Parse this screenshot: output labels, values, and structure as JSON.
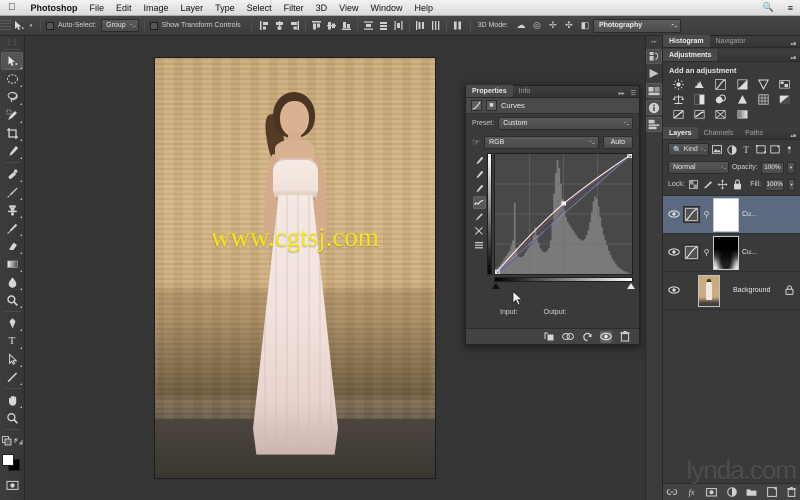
{
  "os_menu": {
    "apple_icon": "apple-icon",
    "items": [
      {
        "label": "Photoshop",
        "bold": true
      },
      {
        "label": "File",
        "bold": false
      },
      {
        "label": "Edit",
        "bold": false
      },
      {
        "label": "Image",
        "bold": false
      },
      {
        "label": "Layer",
        "bold": false
      },
      {
        "label": "Type",
        "bold": false
      },
      {
        "label": "Select",
        "bold": false
      },
      {
        "label": "Filter",
        "bold": false
      },
      {
        "label": "3D",
        "bold": false
      },
      {
        "label": "View",
        "bold": false
      },
      {
        "label": "Window",
        "bold": false
      },
      {
        "label": "Help",
        "bold": false
      }
    ],
    "right_icons": [
      "search-icon",
      "list-icon"
    ]
  },
  "options_bar": {
    "tool_icon": "move-tool-icon",
    "auto_select_label": "Auto-Select:",
    "auto_select_value": "Group",
    "show_transform_label": "Show Transform Controls",
    "threed_mode_label": "3D Mode:",
    "workspace": "Photography",
    "align_icons": [
      "align-left-edges-icon",
      "align-horizontal-centers-icon",
      "align-right-edges-icon",
      "align-top-edges-icon",
      "align-vertical-centers-icon",
      "align-bottom-edges-icon"
    ],
    "distribute_icons": [
      "distribute-top-icon",
      "distribute-vertical-center-icon",
      "distribute-bottom-icon",
      "distribute-left-icon",
      "distribute-horizontal-center-icon",
      "distribute-right-icon"
    ],
    "threed_icons": [
      "orbit-3d-icon",
      "roll-3d-icon",
      "pan-3d-icon",
      "slide-3d-icon",
      "camera-3d-icon"
    ]
  },
  "toolbar": {
    "tools": [
      {
        "name": "move-tool",
        "glyph": "↖",
        "selected": true,
        "has_submenu": true
      },
      {
        "name": "marquee-tool",
        "glyph": "◯",
        "selected": false,
        "has_submenu": true
      },
      {
        "name": "lasso-tool",
        "glyph": "⌀",
        "selected": false,
        "has_submenu": true
      },
      {
        "name": "quick-selection-tool",
        "glyph": "✎",
        "selected": false,
        "has_submenu": true
      },
      {
        "name": "crop-tool",
        "glyph": "⌗",
        "selected": false,
        "has_submenu": true
      },
      {
        "name": "eyedropper-tool",
        "glyph": "✐",
        "selected": false,
        "has_submenu": true
      },
      {
        "name": "spot-healing-brush-tool",
        "glyph": "✒",
        "selected": false,
        "has_submenu": true
      },
      {
        "name": "brush-tool",
        "glyph": "╱",
        "selected": false,
        "has_submenu": true
      },
      {
        "name": "clone-stamp-tool",
        "glyph": "⚓",
        "selected": false,
        "has_submenu": true
      },
      {
        "name": "history-brush-tool",
        "glyph": "✄",
        "selected": false,
        "has_submenu": true
      },
      {
        "name": "eraser-tool",
        "glyph": "▱",
        "selected": false,
        "has_submenu": true
      },
      {
        "name": "gradient-tool",
        "glyph": "▤",
        "selected": false,
        "has_submenu": true
      },
      {
        "name": "blur-tool",
        "glyph": "●",
        "selected": false,
        "has_submenu": true
      },
      {
        "name": "dodge-tool",
        "glyph": "⚲",
        "selected": false,
        "has_submenu": true
      },
      {
        "name": "pen-tool",
        "glyph": "✒",
        "selected": false,
        "has_submenu": true
      },
      {
        "name": "type-tool",
        "glyph": "T",
        "selected": false,
        "has_submenu": true
      },
      {
        "name": "path-selection-tool",
        "glyph": "➤",
        "selected": false,
        "has_submenu": true
      },
      {
        "name": "line-tool",
        "glyph": "╱",
        "selected": false,
        "has_submenu": true
      },
      {
        "name": "hand-tool",
        "glyph": "✋",
        "selected": false,
        "has_submenu": true
      },
      {
        "name": "zoom-tool",
        "glyph": "⚲",
        "selected": false,
        "has_submenu": false
      }
    ],
    "extra": [
      {
        "name": "edit-in-quick-mask-mode",
        "glyph": "▣"
      }
    ],
    "foreground_color": "#ffffff",
    "background_color": "#000000"
  },
  "document": {
    "watermark": "www.cgtsj.com",
    "alt": "bride-in-white-gown-against-stucco-wall"
  },
  "properties_panel": {
    "tabs": [
      {
        "label": "Properties",
        "active": true
      },
      {
        "label": "Info",
        "active": false
      }
    ],
    "title": "Curves",
    "preset_label": "Preset:",
    "preset_value": "Custom",
    "channel_value": "RGB",
    "auto_label": "Auto",
    "input_label": "Input:",
    "output_label": "Output:",
    "curve_tools": [
      {
        "name": "white-point-eyedropper",
        "glyph": "✐",
        "active": false
      },
      {
        "name": "gray-point-eyedropper",
        "glyph": "✐",
        "active": false
      },
      {
        "name": "black-point-eyedropper",
        "glyph": "✐",
        "active": false
      },
      {
        "name": "edit-points-curve-tool",
        "glyph": "∿",
        "active": true
      },
      {
        "name": "pencil-draw-curve-tool",
        "glyph": "✒",
        "active": false
      },
      {
        "name": "smooth-curve-tool",
        "glyph": "✂",
        "active": false
      },
      {
        "name": "curve-display-options",
        "glyph": "☰",
        "active": false
      }
    ],
    "footer_icons": [
      {
        "name": "clip-to-layer-icon",
        "glyph": "↳",
        "active": false
      },
      {
        "name": "view-previous-state-icon",
        "glyph": "◔",
        "active": false
      },
      {
        "name": "reset-adjustment-icon",
        "glyph": "↺",
        "active": false
      },
      {
        "name": "toggle-layer-visibility-icon",
        "glyph": "◉",
        "active": true
      },
      {
        "name": "delete-adjustment-icon",
        "glyph": "Ὕ1",
        "active": false
      }
    ]
  },
  "curve_data": {
    "type": "line",
    "title": "RGB Curve",
    "xlabel": "Input",
    "ylabel": "Output",
    "xlim": [
      0,
      255
    ],
    "ylim": [
      0,
      255
    ],
    "grid": true,
    "control_points": [
      {
        "input": 0,
        "output": 0
      },
      {
        "input": 128,
        "output": 150
      },
      {
        "input": 255,
        "output": 255
      }
    ],
    "baseline": [
      {
        "input": 0,
        "output": 0
      },
      {
        "input": 255,
        "output": 255
      }
    ],
    "histogram": [
      4,
      5,
      6,
      8,
      10,
      12,
      14,
      16,
      18,
      22,
      26,
      55,
      20,
      14,
      13,
      13,
      14,
      16,
      18,
      20,
      22,
      25,
      30,
      36,
      30,
      24,
      20,
      18,
      17,
      17,
      18,
      20,
      26,
      40,
      62,
      78,
      88,
      82,
      70,
      58,
      50,
      44,
      40,
      38,
      36,
      34,
      32,
      30,
      28,
      27,
      26,
      26,
      27,
      30,
      34,
      40,
      48,
      56,
      60,
      58,
      52,
      44,
      36,
      30,
      26,
      22,
      18,
      15,
      12,
      10,
      8,
      6,
      5,
      4,
      3,
      2,
      2,
      1,
      1,
      0
    ]
  },
  "right_rail": {
    "icons": [
      {
        "name": "mini-bridge-icon",
        "glyph": "⧉",
        "active": false
      },
      {
        "name": "timeline-play-icon",
        "glyph": "▶",
        "active": false
      },
      {
        "name": "histogram-rail-icon",
        "glyph": "▦",
        "active": true
      },
      {
        "name": "info-rail-icon",
        "glyph": "ⓘ",
        "active": true
      },
      {
        "name": "layers-rail-icon",
        "glyph": "▤",
        "active": true
      }
    ]
  },
  "histogram_panel": {
    "tabs": [
      {
        "label": "Histogram",
        "active": true
      },
      {
        "label": "Navigator",
        "active": false
      }
    ]
  },
  "adjustments_panel": {
    "tabs": [
      {
        "label": "Adjustments",
        "active": true
      }
    ],
    "heading": "Add an adjustment",
    "icons": [
      {
        "name": "brightness-contrast-icon",
        "glyph": "☀"
      },
      {
        "name": "levels-icon",
        "glyph": "▂"
      },
      {
        "name": "curves-icon",
        "glyph": "↗"
      },
      {
        "name": "exposure-icon",
        "glyph": "◧"
      },
      {
        "name": "vibrance-icon",
        "glyph": "▽"
      },
      {
        "name": "hue-saturation-icon",
        "glyph": "▥"
      },
      {
        "name": "color-balance-icon",
        "glyph": "⚖"
      },
      {
        "name": "black-and-white-icon",
        "glyph": "◐"
      },
      {
        "name": "photo-filter-icon",
        "glyph": "◑"
      },
      {
        "name": "channel-mixer-icon",
        "glyph": "△"
      },
      {
        "name": "color-lookup-icon",
        "glyph": "▦"
      },
      {
        "name": "invert-icon",
        "glyph": "◨"
      },
      {
        "name": "posterize-icon",
        "glyph": "◩"
      },
      {
        "name": "threshold-icon",
        "glyph": "◪"
      },
      {
        "name": "gradient-map-icon",
        "glyph": "◫"
      },
      {
        "name": "selective-color-icon",
        "glyph": "◬"
      }
    ]
  },
  "layers_panel": {
    "tabs": [
      {
        "label": "Layers",
        "active": true
      },
      {
        "label": "Channels",
        "active": false
      },
      {
        "label": "Paths",
        "active": false
      }
    ],
    "filter_label": "Kind",
    "filter_icons": [
      {
        "name": "filter-pixel-layers-icon",
        "glyph": "▣"
      },
      {
        "name": "filter-adjustment-layers-icon",
        "glyph": "◑"
      },
      {
        "name": "filter-type-layers-icon",
        "glyph": "T"
      },
      {
        "name": "filter-shape-layers-icon",
        "glyph": "□"
      },
      {
        "name": "filter-smart-objects-icon",
        "glyph": "◱"
      },
      {
        "name": "filter-toggle-icon",
        "glyph": "▌"
      }
    ],
    "blend_mode": "Normal",
    "opacity_label": "Opacity:",
    "opacity_value": "100%",
    "lock_label": "Lock:",
    "fill_label": "Fill:",
    "fill_value": "100%",
    "lock_icons": [
      {
        "name": "lock-transparent-pixels-icon",
        "glyph": "░"
      },
      {
        "name": "lock-image-pixels-icon",
        "glyph": "╱"
      },
      {
        "name": "lock-position-icon",
        "glyph": "✥"
      },
      {
        "name": "lock-all-icon",
        "glyph": "ὑ2"
      }
    ],
    "layers": [
      {
        "name": "Cu...",
        "type": "curves-adjustment",
        "visible": true,
        "selected": true,
        "mask": "white",
        "linked": true,
        "locked": false
      },
      {
        "name": "Cu...",
        "type": "curves-adjustment",
        "visible": true,
        "selected": false,
        "mask": "black-gradient",
        "linked": true,
        "locked": false
      },
      {
        "name": "Background",
        "type": "image",
        "visible": true,
        "selected": false,
        "mask": "none",
        "linked": false,
        "locked": true
      }
    ],
    "footer_icons": [
      {
        "name": "link-layers-icon",
        "glyph": "⚭"
      },
      {
        "name": "layer-style-icon",
        "glyph": "fx"
      },
      {
        "name": "add-layer-mask-icon",
        "glyph": "▣"
      },
      {
        "name": "new-adjustment-layer-icon",
        "glyph": "◑"
      },
      {
        "name": "new-group-icon",
        "glyph": "▰"
      },
      {
        "name": "new-layer-icon",
        "glyph": "⧉"
      },
      {
        "name": "delete-layer-icon",
        "glyph": "Ὕ1"
      }
    ],
    "watermark": "lynda.com"
  },
  "colors": {
    "chrome": "#3a3a3a",
    "panel_header": "#4a4a4a",
    "selected_layer": "#5b6a80",
    "watermark_yellow": "#f5e61e",
    "text": "#e6e6e6"
  }
}
